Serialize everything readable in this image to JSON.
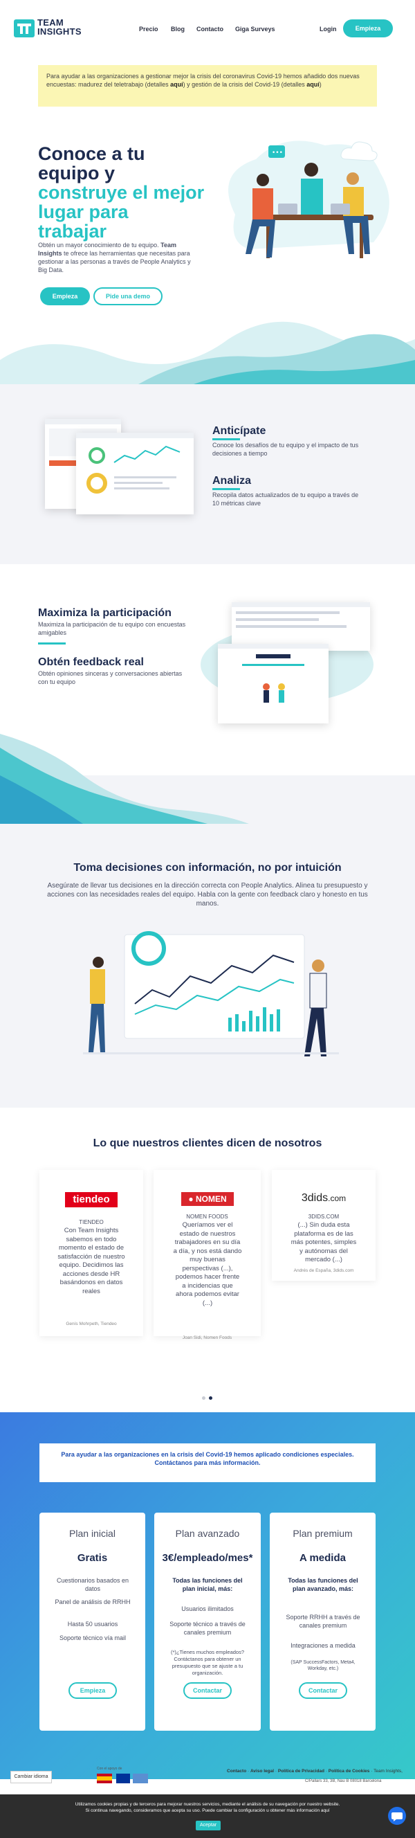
{
  "brand": {
    "line1": "TEAM",
    "line2": "INSIGHTS",
    "accent": "#27c3c4",
    "navy": "#1d2b4f"
  },
  "nav": {
    "items": [
      "Precio",
      "Blog",
      "Contacto",
      "Giga Surveys"
    ],
    "login": "Login",
    "cta": "Empieza"
  },
  "notice": {
    "p1": "Para ayudar a las organizaciones a gestionar mejor la crisis del coronavirus Covid-19 hemos añadido dos nuevas encuestas: madurez del teletrabajo (detalles ",
    "link1": "aquí",
    "p2": ") y gestión de la crisis del Covid-19 (detalles ",
    "link2": "aquí",
    "p3": ")"
  },
  "hero": {
    "title1": "Conoce a tu",
    "title2": "equipo y",
    "title3": "construye el mejor",
    "title4": "lugar para",
    "title5": "trabajar",
    "desc1": "Obtén un mayor conocimiento de tu equipo. ",
    "desc_brand": "Team Insights",
    "desc2": " te ofrece las herramientas que necesitas para gestionar a las personas a través de People Analytics y Big Data.",
    "btn_primary": "Empieza",
    "btn_secondary": "Pide una demo"
  },
  "features1": [
    {
      "title": "Anticípate",
      "text": "Conoce los desafíos de tu equipo y el impacto de tus decisiones a tiempo"
    },
    {
      "title": "Analiza",
      "text": "Recopila datos actualizados de tu equipo a través de 10 métricas clave"
    }
  ],
  "features2": [
    {
      "title": "Maximiza la participación",
      "text": "Maximiza la participación de tu equipo con encuestas amigables"
    },
    {
      "title": "Obtén feedback real",
      "text": "Obtén opiniones sinceras y conversaciones abiertas con tu equipo"
    }
  ],
  "decisions": {
    "title": "Toma decisiones con información, no por intuición",
    "text": "Asegúrate de llevar tus decisiones en la dirección correcta con People Analytics. Alinea tu presupuesto y acciones con las necesidades reales del equipo. Habla con la gente con feedback claro y honesto en tus manos."
  },
  "testimonials": {
    "title": "Lo que nuestros clientes dicen de nosotros",
    "items": [
      {
        "logo": "tiendeo",
        "company": "TIENDEO",
        "quote": "Con Team Insights sabemos en todo momento el estado de satisfacción de nuestro equipo. Decidimos las acciones desde HR basándonos en datos reales",
        "author": "Genís Mohrpeth, Tiendeo"
      },
      {
        "logo": "NOMEN",
        "company": "NOMEN FOODS",
        "quote": "Queríamos ver el estado de nuestros trabajadores en su día a día, y nos está dando muy buenas perspectivas (...), podemos hacer frente a incidencias que ahora podemos evitar (...)",
        "author": "Joan Sidi, Nomen Foods"
      },
      {
        "logo": "3dids",
        "logo_suffix": ".com",
        "company": "3DIDS.COM",
        "quote": "(...) Sin duda esta plataforma es de las más potentes, simples y autónomas del mercado (...)",
        "author": "Andrés de España, 3dids.com"
      }
    ]
  },
  "covid_banner": {
    "line1": "Para ayudar a las organizaciones en la crisis del Covid-19 hemos aplicado condiciones especiales.",
    "line2": "Contáctanos para más información."
  },
  "pricing": [
    {
      "name": "Plan inicial",
      "price": "Gratis",
      "features": [
        "Cuestionarios basados en datos",
        "Panel de análisis de RRHH",
        "Hasta 50 usuarios",
        "Soporte técnico vía mail"
      ],
      "cta": "Empieza"
    },
    {
      "name": "Plan avanzado",
      "price": "3€/empleado/mes*",
      "intro": "Todas las funciones del plan inicial, más:",
      "features": [
        "Usuarios ilimitados",
        "Soporte técnico a través de canales premium"
      ],
      "note": "(*)¿Tienes muchos empleados? Contáctanos para obtener un presupuesto que se ajuste a tu organización.",
      "cta": "Contactar"
    },
    {
      "name": "Plan premium",
      "price": "A medida",
      "intro": "Todas las funciones del plan avanzado, más:",
      "features": [
        "Soporte RRHH a través de canales premium",
        "Integraciones a medida"
      ],
      "note": "(SAP SuccessFactors, Meta4, Workday, etc.)",
      "cta": "Contactar"
    }
  ],
  "footer": {
    "language": "Cambiar idioma",
    "funded": "Con el apoyo de",
    "links": [
      "Contacto",
      "Aviso legal",
      "Política de Privacidad",
      "Política de Cookies"
    ],
    "company": "Team Insights,",
    "address": "C/Pallars 33, 3B, Nau B 08018 Barcelona"
  },
  "cookies": {
    "text1": "Utilizamos cookies propias y de terceros para mejorar nuestros servicios, mediante el análisis de su navegación por nuestro website.",
    "text2": "Si continua navegando, consideramos que acepta su uso. Puede cambiar la configuración u obtener más información aquí",
    "accept": "Aceptar"
  },
  "hero_illustration": {
    "chat_icon": "chat-bubble-icon",
    "cloud_icon": "cloud-icon"
  }
}
